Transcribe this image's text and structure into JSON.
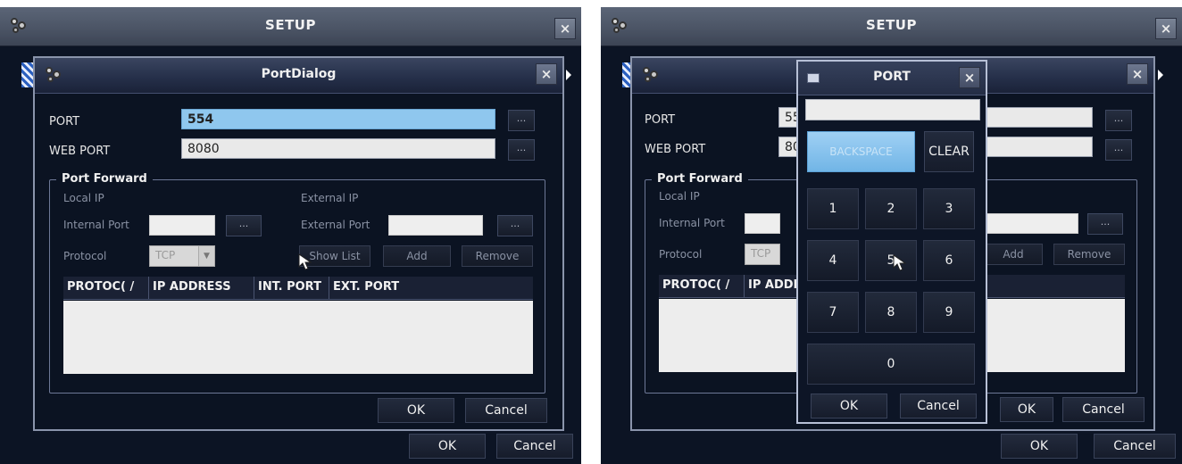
{
  "left": {
    "setup_title": "SETUP",
    "dialog": {
      "title": "PortDialog",
      "port_label": "PORT",
      "port_value": "554",
      "web_port_label": "WEB PORT",
      "web_port_value": "8080",
      "dots": "...",
      "group_title": "Port Forward",
      "local_ip_label": "Local IP",
      "external_ip_label": "External IP",
      "internal_port_label": "Internal Port",
      "external_port_label": "External Port",
      "protocol_label": "Protocol",
      "protocol_value": "TCP",
      "show_list": "Show List",
      "add": "Add",
      "remove": "Remove",
      "table_headers": [
        "PROTOC(  /",
        "IP ADDRESS",
        "INT. PORT",
        "EXT. PORT"
      ],
      "ok": "OK",
      "cancel": "Cancel"
    },
    "setup_ok": "OK",
    "setup_cancel": "Cancel",
    "close_glyph": "×"
  },
  "right": {
    "setup_title": "SETUP",
    "dialog": {
      "port_label": "PORT",
      "port_value_partial": "55",
      "web_port_label": "WEB PORT",
      "web_port_value_partial": "80",
      "dots": "...",
      "group_title": "Port Forward",
      "local_ip_label": "Local IP",
      "internal_port_label": "Internal Port",
      "protocol_label": "Protocol",
      "protocol_value": "TCP",
      "add": "Add",
      "remove": "Remove",
      "table_headers": [
        "PROTOC(  /",
        "IP ADDF"
      ],
      "ok": "OK",
      "cancel": "Cancel"
    },
    "keypad": {
      "title": "PORT",
      "backspace": "BACKSPACE",
      "clear": "CLEAR",
      "keys": [
        "1",
        "2",
        "3",
        "4",
        "5",
        "6",
        "7",
        "8",
        "9"
      ],
      "zero": "0",
      "ok": "OK",
      "cancel": "Cancel"
    },
    "setup_ok": "OK",
    "setup_cancel": "Cancel",
    "close_glyph": "×"
  },
  "icons": {
    "app": "app-logo-icon",
    "close": "close-icon",
    "cursor": "mouse-pointer-icon",
    "dropdown": "chevron-down-icon",
    "keypad": "keyboard-icon"
  },
  "colors": {
    "background": "#0c1424",
    "titlebar": "#4a5364",
    "selected_field": "#8fc7ee",
    "field": "#e9e9e9"
  }
}
